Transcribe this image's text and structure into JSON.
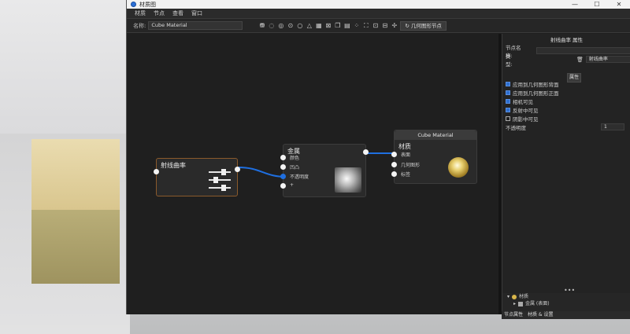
{
  "window": {
    "title": "材质图",
    "close": "✕",
    "minimize": "—",
    "maximize": "☐"
  },
  "menu": {
    "items": [
      "材质",
      "节点",
      "查看",
      "窗口"
    ]
  },
  "toolbar": {
    "name_label": "名称:",
    "name_value": "Cube Material",
    "geometry_button": "几何图形节点"
  },
  "nodes": {
    "ramp": {
      "title": "射线曲率"
    },
    "metal": {
      "title": "金属",
      "inputs": [
        "颜色",
        "凹凸",
        "不透明度",
        "+"
      ]
    },
    "material": {
      "header": "Cube Material",
      "title": "材质",
      "inputs": [
        "表面",
        "几何图形",
        "标签"
      ]
    }
  },
  "panel": {
    "header": "射线曲率 属性",
    "node_name_label": "节点名称:",
    "type_label": "类型:",
    "type_value": "射线曲率",
    "attr_button": "属性",
    "checkboxes": [
      {
        "label": "应用到几何图形背面",
        "checked": true
      },
      {
        "label": "应用到几何图形正面",
        "checked": true
      },
      {
        "label": "相机可见",
        "checked": true
      },
      {
        "label": "反射中可见",
        "checked": true
      },
      {
        "label": "阴影中可见",
        "checked": false
      }
    ],
    "opacity_label": "不透明度",
    "opacity_value": "1"
  },
  "tree": {
    "root": "材质",
    "child": "金属 (表面)"
  },
  "tabs": {
    "node_props": "节点属性",
    "material_settings": "材质 & 设置"
  },
  "colors": {
    "link": "#1f6fe0",
    "accent": "#2d6fd0",
    "ramp_border": "#8b5a2b"
  }
}
